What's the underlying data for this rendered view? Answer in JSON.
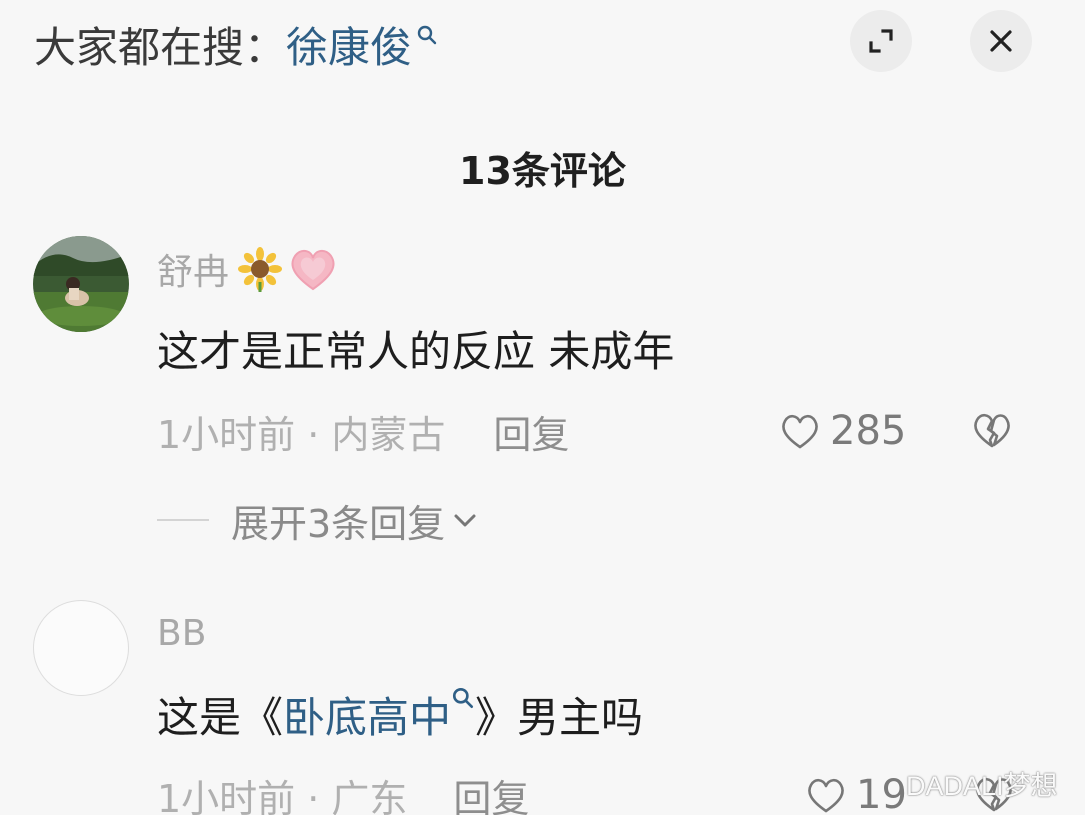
{
  "header": {
    "search_prefix": "大家都在搜：",
    "search_term": "徐康俊"
  },
  "controls": {
    "expand_icon": "expand-icon",
    "close_icon": "close-icon"
  },
  "comments_section": {
    "title": "13条评论"
  },
  "comments": [
    {
      "username": "舒冉",
      "badges": [
        "sunflower-emoji",
        "heart-emoji"
      ],
      "text": "这才是正常人的反应 未成年",
      "time_location": "1小时前 · 内蒙古",
      "reply_label": "回复",
      "likes": "285",
      "expand_replies_label": "展开3条回复"
    },
    {
      "username": "BB",
      "text_before": "这是《",
      "link_text": "卧底高中",
      "text_after": "》男主吗",
      "time_location": "1小时前 · 广东",
      "reply_label": "回复",
      "likes": "19"
    }
  ],
  "watermark": "DADALI梦想",
  "colors": {
    "link": "#2f5f86",
    "background": "#f7f7f7",
    "muted_text": "#a8a8a8"
  }
}
